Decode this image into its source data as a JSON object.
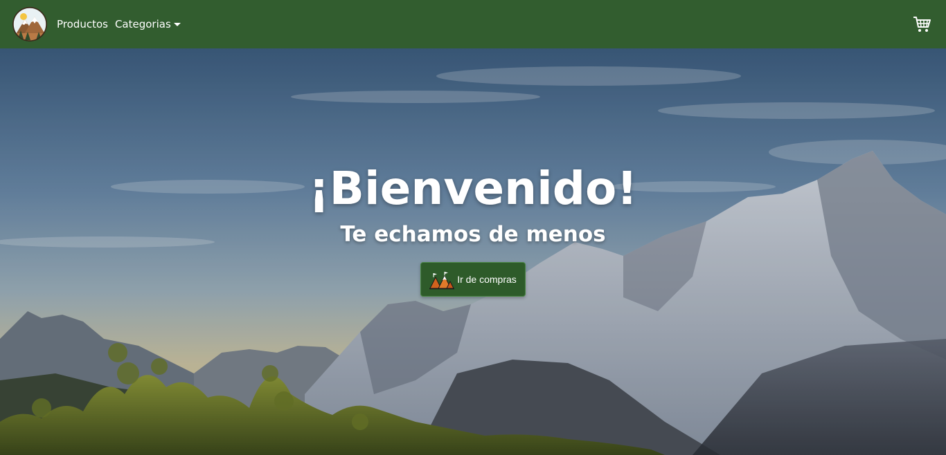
{
  "navbar": {
    "brand_icon": "mountain-logo-icon",
    "links": [
      {
        "label": "Productos"
      },
      {
        "label": "Categorias",
        "has_dropdown": true
      }
    ],
    "cart_icon": "shopping-cart-icon",
    "background_color": "#325d2f"
  },
  "hero": {
    "title": "¡Bienvenido!",
    "subtitle": "Te echamos de menos",
    "button": {
      "label": "Ir de compras",
      "icon": "mountain-camp-icon",
      "background_color": "#2e5b2a"
    }
  }
}
